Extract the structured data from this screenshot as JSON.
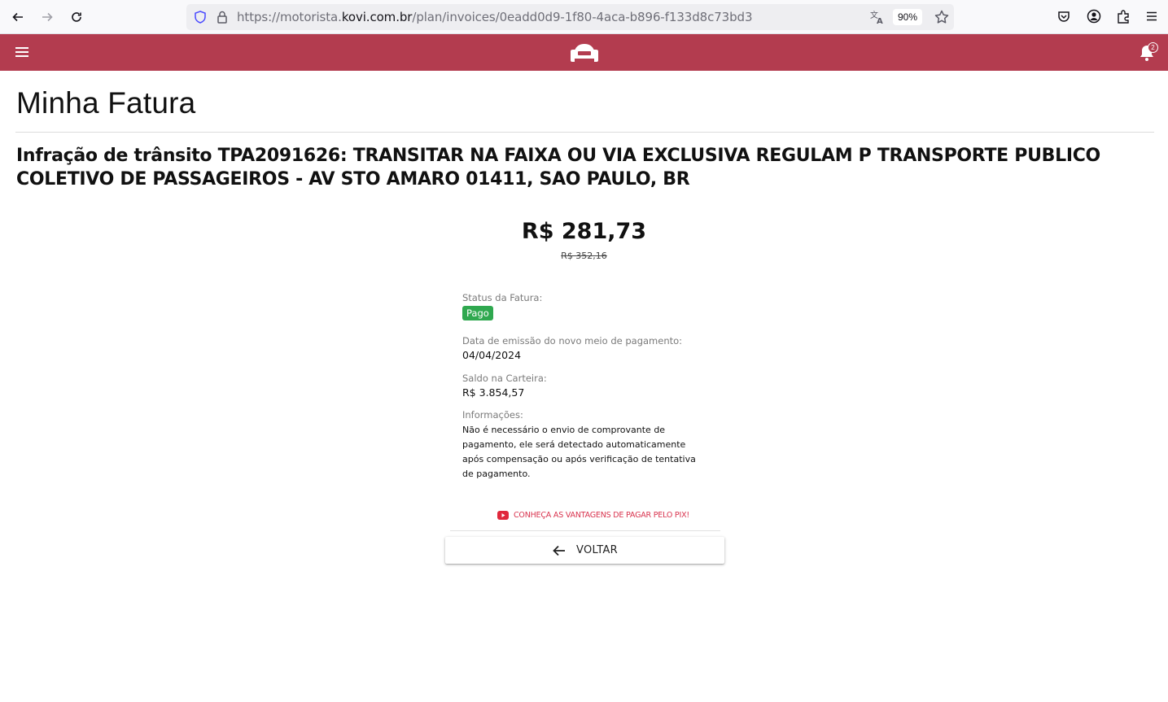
{
  "browser": {
    "url_prefix": "https://motorista.",
    "url_domain": "kovi.com.br",
    "url_path": "/plan/invoices/0eadd0d9-1f80-4aca-b896-f133d8c73bd3",
    "zoom": "90%"
  },
  "appbar": {
    "brand_color": "#b33c4f",
    "notification_count": "2"
  },
  "page": {
    "title": "Minha Fatura",
    "description": "Infração de trânsito TPA2091626: TRANSITAR NA FAIXA OU VIA EXCLUSIVA REGULAM P TRANSPORTE PUBLICO COLETIVO DE PASSAGEIROS - AV STO AMARO 01411, SAO PAULO, BR"
  },
  "invoice": {
    "amount": "R$ 281,73",
    "original_amount": "R$ 352,16",
    "status_label": "Status da Fatura:",
    "status_value": "Pago",
    "status_color": "#2fa84f",
    "issue_date_label": "Data de emissão do novo meio de pagamento:",
    "issue_date_value": "04/04/2024",
    "wallet_label": "Saldo na Carteira:",
    "wallet_value": "R$ 3.854,57",
    "info_label": "Informações:",
    "info_value": "Não é necessário o envio de comprovante de pagamento, ele será detectado automaticamente após compensação ou após verificação de tentativa de pagamento."
  },
  "actions": {
    "pix_link": "CONHEÇA AS VANTAGENS DE PAGAR PELO PIX!",
    "back_label": "VOLTAR"
  }
}
